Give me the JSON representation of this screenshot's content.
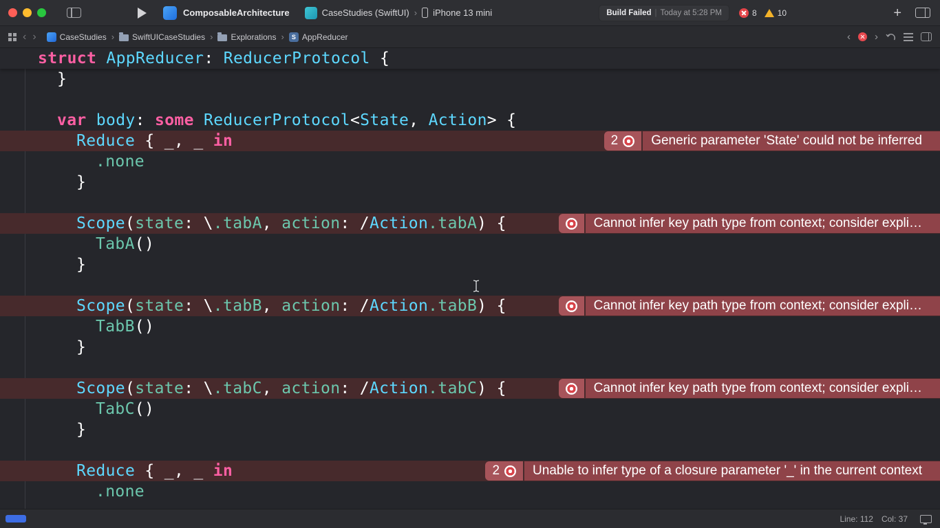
{
  "icons": {
    "chevron_left": "‹",
    "chevron_right": "›",
    "plus": "+",
    "swift_badge": "S"
  },
  "titlebar": {
    "project_title": "ComposableArchitecture",
    "scheme": "CaseStudies (SwiftUI)",
    "destination": "iPhone 13 mini",
    "status_build": "Build Failed",
    "status_sep": "|",
    "status_time": "Today at 5:28 PM",
    "error_count": "8",
    "warning_count": "10"
  },
  "jumpbar": {
    "crumbs": [
      {
        "label": "CaseStudies"
      },
      {
        "label": "SwiftUICaseStudies"
      },
      {
        "label": "Explorations"
      },
      {
        "label": "AppReducer"
      }
    ]
  },
  "statusbar": {
    "line": "Line: 112",
    "col": "Col: 37"
  },
  "editor": {
    "code": {
      "sticky": {
        "indent": 0,
        "segs": [
          [
            "k",
            "struct"
          ],
          [
            "p",
            " "
          ],
          [
            "c",
            "AppReducer"
          ],
          [
            "p",
            ": "
          ],
          [
            "c",
            "ReducerProtocol"
          ],
          [
            "p",
            " {"
          ]
        ]
      },
      "lines": [
        {
          "indent": 1,
          "segs": [
            [
              "p",
              "}"
            ]
          ]
        },
        {
          "indent": 0,
          "segs": []
        },
        {
          "indent": 1,
          "segs": [
            [
              "k",
              "var"
            ],
            [
              "p",
              " "
            ],
            [
              "c",
              "body"
            ],
            [
              "p",
              ": "
            ],
            [
              "k",
              "some"
            ],
            [
              "p",
              " "
            ],
            [
              "c",
              "ReducerProtocol"
            ],
            [
              "p",
              "<"
            ],
            [
              "c",
              "State"
            ],
            [
              "p",
              ", "
            ],
            [
              "c",
              "Action"
            ],
            [
              "p",
              "> {"
            ]
          ]
        },
        {
          "indent": 2,
          "segs": [
            [
              "c",
              "Reduce"
            ],
            [
              "p",
              " { _, _ "
            ],
            [
              "k",
              "in"
            ]
          ],
          "err": {
            "count": "2",
            "msg": "Generic parameter 'State' could not be inferred"
          }
        },
        {
          "indent": 3,
          "segs": [
            [
              "m",
              ".none"
            ]
          ]
        },
        {
          "indent": 2,
          "segs": [
            [
              "p",
              "}"
            ]
          ]
        },
        {
          "indent": 0,
          "segs": []
        },
        {
          "indent": 2,
          "segs": [
            [
              "c",
              "Scope"
            ],
            [
              "p",
              "("
            ],
            [
              "m",
              "state"
            ],
            [
              "p",
              ": \\"
            ],
            [
              "m",
              ".tabA"
            ],
            [
              "p",
              ", "
            ],
            [
              "m",
              "action"
            ],
            [
              "p",
              ": /"
            ],
            [
              "c",
              "Action"
            ],
            [
              "m",
              ".tabA"
            ],
            [
              "p",
              ") {"
            ]
          ],
          "err": {
            "msg": "Cannot infer key path type from context; consider expli…"
          }
        },
        {
          "indent": 3,
          "segs": [
            [
              "m",
              "TabA"
            ],
            [
              "p",
              "()"
            ]
          ]
        },
        {
          "indent": 2,
          "segs": [
            [
              "p",
              "}"
            ]
          ]
        },
        {
          "indent": 0,
          "segs": []
        },
        {
          "indent": 2,
          "segs": [
            [
              "c",
              "Scope"
            ],
            [
              "p",
              "("
            ],
            [
              "m",
              "state"
            ],
            [
              "p",
              ": \\"
            ],
            [
              "m",
              ".tabB"
            ],
            [
              "p",
              ", "
            ],
            [
              "m",
              "action"
            ],
            [
              "p",
              ": /"
            ],
            [
              "c",
              "Action"
            ],
            [
              "m",
              ".tabB"
            ],
            [
              "p",
              ") {"
            ]
          ],
          "err": {
            "msg": "Cannot infer key path type from context; consider expli…"
          }
        },
        {
          "indent": 3,
          "segs": [
            [
              "m",
              "TabB"
            ],
            [
              "p",
              "()"
            ]
          ]
        },
        {
          "indent": 2,
          "segs": [
            [
              "p",
              "}"
            ]
          ]
        },
        {
          "indent": 0,
          "segs": []
        },
        {
          "indent": 2,
          "segs": [
            [
              "c",
              "Scope"
            ],
            [
              "p",
              "("
            ],
            [
              "m",
              "state"
            ],
            [
              "p",
              ": \\"
            ],
            [
              "m",
              ".tabC"
            ],
            [
              "p",
              ", "
            ],
            [
              "m",
              "action"
            ],
            [
              "p",
              ": /"
            ],
            [
              "c",
              "Action"
            ],
            [
              "m",
              ".tabC"
            ],
            [
              "p",
              ") {"
            ]
          ],
          "err": {
            "msg": "Cannot infer key path type from context; consider expli…"
          }
        },
        {
          "indent": 3,
          "segs": [
            [
              "m",
              "TabC"
            ],
            [
              "p",
              "()"
            ]
          ]
        },
        {
          "indent": 2,
          "segs": [
            [
              "p",
              "}"
            ]
          ]
        },
        {
          "indent": 0,
          "segs": []
        },
        {
          "indent": 2,
          "segs": [
            [
              "c",
              "Reduce"
            ],
            [
              "p",
              " { _, _ "
            ],
            [
              "k",
              "in"
            ]
          ],
          "err": {
            "count": "2",
            "msg": "Unable to infer type of a closure parameter '_' in the current context"
          }
        },
        {
          "indent": 3,
          "segs": [
            [
              "m",
              ".none"
            ]
          ]
        }
      ]
    }
  }
}
